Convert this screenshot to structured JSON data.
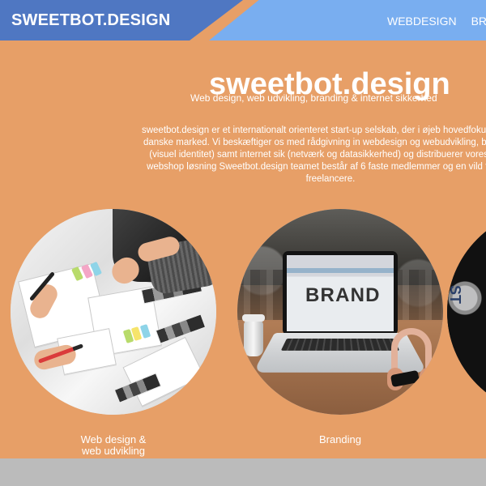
{
  "header": {
    "logo": "SWEETBOT.DESIGN",
    "nav": [
      {
        "label": "WEBDESIGN"
      },
      {
        "label": "BRA"
      }
    ]
  },
  "intro": {
    "title": "sweetbot.design",
    "tagline": "Web design, web udvikling, branding & internet sikkerhed",
    "description": "sweetbot.design er et internationalt orienteret start-up selskab, der i øjeb hovedfokus på det danske marked. Vi beskæftiger os med rådgivning in webdesign og webudvikling, branding (visuel identitet) samt internet sik (netværk og datasikkerhed) og distribuerer vores egen webshop løsning Sweetbot.design teamet består af 6 faste medlemmer og en vild flok tilh freelancere."
  },
  "services": [
    {
      "label": "Web design &\nweb udvikling",
      "icon": "design-workspace-photo"
    },
    {
      "label": "Branding",
      "icon": "laptop-branding-photo",
      "screen_text": "BRAND"
    },
    {
      "label": "",
      "icon": "cropped-service-photo"
    }
  ],
  "colors": {
    "page_background": "#e79f67",
    "logo_blue": "#4f77c2",
    "nav_blue": "#79aef0",
    "footer_gray": "#bbbbbb",
    "text": "#ffffff"
  }
}
